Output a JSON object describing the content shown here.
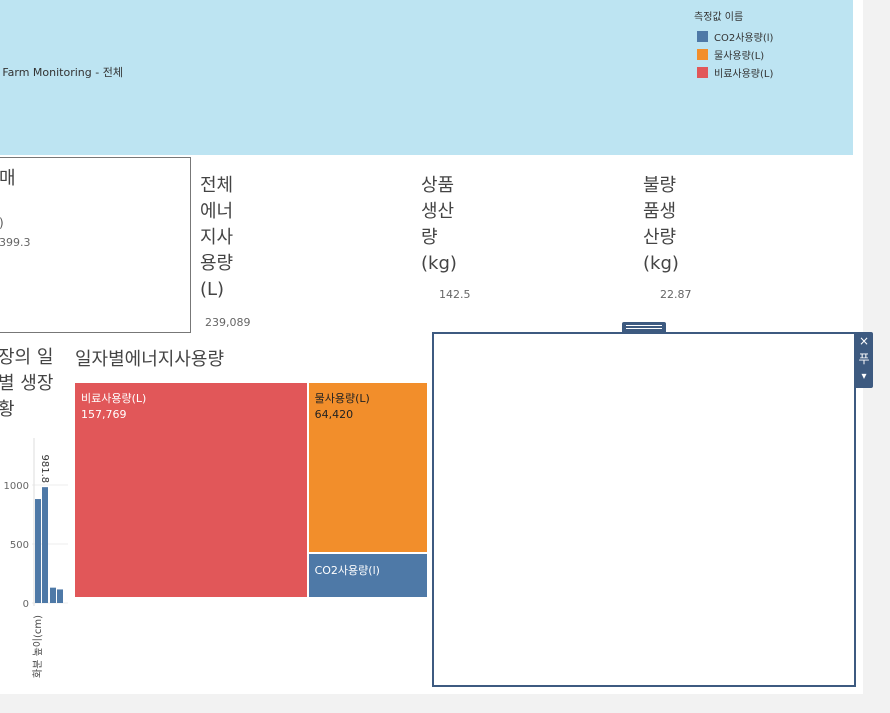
{
  "header": {
    "subtitle": "rt Farm Monitoring - 전체"
  },
  "legend": {
    "title": "측정값 이름",
    "items": [
      {
        "label": "CO2사용량(l)",
        "color": "#4e79a7"
      },
      {
        "label": "물사용량(L)",
        "color": "#f28e2b"
      },
      {
        "label": "비료사용량(L)",
        "color": "#e15759"
      }
    ]
  },
  "card_box": {
    "title": "매",
    "unit": ")",
    "value": "399.3"
  },
  "kpis": [
    {
      "title_lines": [
        "전체",
        "에너",
        "지사",
        "용량",
        "(L)"
      ],
      "value": "239,089"
    },
    {
      "title_lines": [
        "상품",
        "생산",
        "량",
        "(kg)"
      ],
      "value": "142.5"
    },
    {
      "title_lines": [
        "불량",
        "품생",
        "산량",
        "(kg)"
      ],
      "value": "22.87"
    }
  ],
  "growth_panel": {
    "title_lines": [
      "장의 일",
      "별 생장",
      "황"
    ]
  },
  "treemap": {
    "title": "일자별에너지사용량"
  },
  "panel_toolbar": {
    "close_glyph": "×",
    "pin_glyph": "푸",
    "menu_glyph": "▾"
  },
  "chart_data": [
    {
      "type": "bar",
      "title": "",
      "ylabel": "화분 높이(cm)",
      "ylim": [
        0,
        1100
      ],
      "yticks": [
        0,
        500,
        1000
      ],
      "values": [
        881,
        981.8,
        130,
        115
      ],
      "data_labels": [
        "",
        "981.8",
        "",
        ""
      ],
      "color": "#4e79a7"
    },
    {
      "type": "treemap",
      "categories": [
        "비료사용량(L)",
        "물사용량(L)",
        "CO2사용량(l)"
      ],
      "values": [
        157769,
        64420,
        16900
      ],
      "value_labels": [
        "157,769",
        "64,420",
        ""
      ],
      "colors": [
        "#e15759",
        "#f28e2b",
        "#4e79a7"
      ]
    }
  ]
}
